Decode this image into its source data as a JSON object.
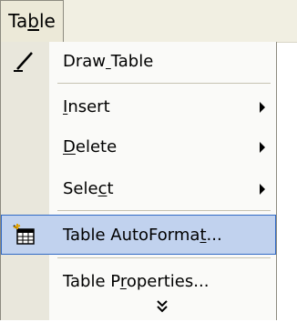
{
  "menubar": {
    "title": "Table",
    "title_hotkey_index": 2
  },
  "menu": {
    "items": [
      {
        "label": "Draw Table",
        "hotkey_index": 4,
        "icon": "pencil-icon"
      },
      {
        "label": "Insert",
        "hotkey_index": 0,
        "submenu": true
      },
      {
        "label": "Delete",
        "hotkey_index": 0,
        "submenu": true
      },
      {
        "label": "Select",
        "hotkey_index": 4,
        "submenu": true
      },
      {
        "label": "Table AutoFormat...",
        "hotkey_index": 15,
        "icon": "table-autoformat-icon",
        "highlighted": true
      },
      {
        "label": "Table Properties...",
        "hotkey_index": 7
      }
    ],
    "expand_glyph": "expand-chevron-icon"
  },
  "colors": {
    "highlight_fill": "#c1d2ee",
    "highlight_border": "#316ac5",
    "gutter": "#e9e7dc",
    "menu_bg": "#fafaf8"
  }
}
